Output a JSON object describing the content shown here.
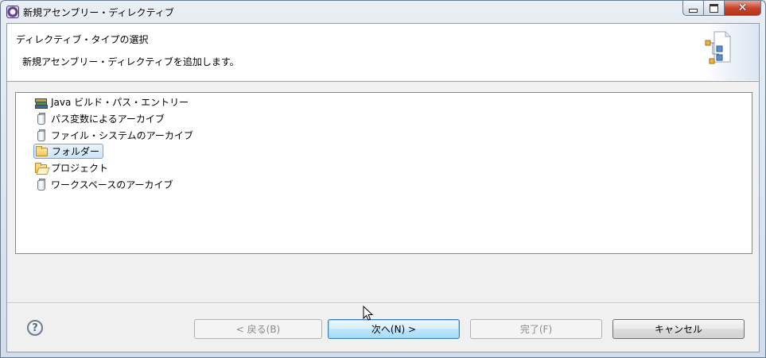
{
  "window": {
    "title": "新規アセンブリー・ディレクティブ",
    "app_icon": "eclipse-icon",
    "controls": [
      "minimize-icon",
      "maximize-icon",
      "close-icon"
    ]
  },
  "banner": {
    "title": "ディレクティブ・タイプの選択",
    "description": "新規アセンブリー・ディレクティブを追加します。",
    "graphic": "wizard-banner-icon"
  },
  "list": {
    "items": [
      {
        "label": "Java ビルド・パス・エントリー",
        "icon": "java-build-path-icon",
        "selected": false
      },
      {
        "label": "パス変数によるアーカイブ",
        "icon": "jar-icon",
        "selected": false
      },
      {
        "label": "ファイル・システムのアーカイブ",
        "icon": "jar-icon",
        "selected": false
      },
      {
        "label": "フォルダー",
        "icon": "folder-icon",
        "selected": true
      },
      {
        "label": "プロジェクト",
        "icon": "project-icon",
        "selected": false
      },
      {
        "label": "ワークスペースのアーカイブ",
        "icon": "jar-icon",
        "selected": false
      }
    ]
  },
  "buttons": {
    "help_icon": "help-icon",
    "help_glyph": "?",
    "back": "< 戻る(B)",
    "next": "次へ(N) >",
    "finish": "完了(F)",
    "cancel": "キャンセル"
  },
  "colors": {
    "selection_bg": "#cde4f8",
    "selection_border": "#7da2ce",
    "default_button_border": "#3c7fb1",
    "close_button": "#c8452c"
  }
}
